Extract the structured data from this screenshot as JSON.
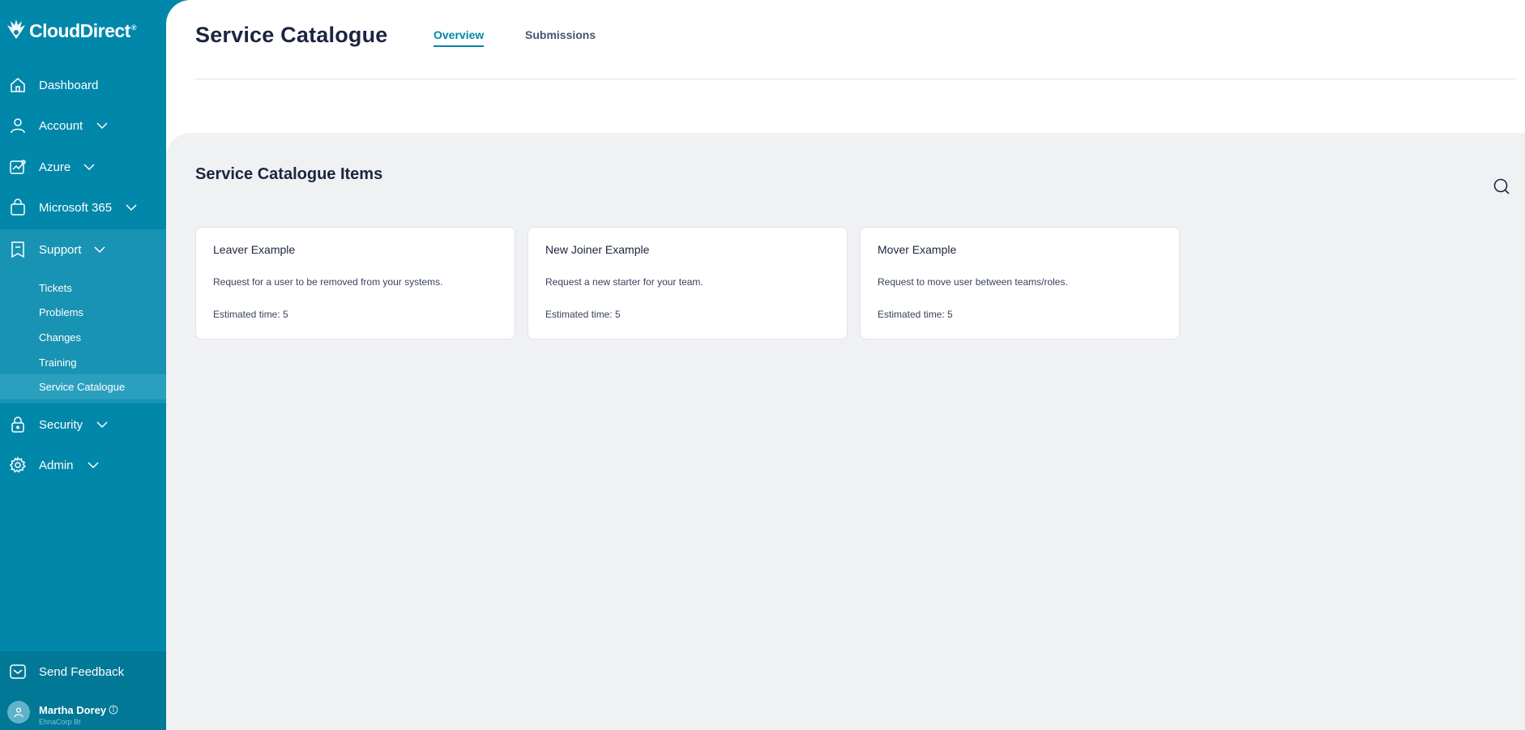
{
  "brand": {
    "name": "CloudDirect",
    "reg": "®",
    "primary_color": "#0087aa",
    "icon": "flame-logo-icon"
  },
  "sidebar": {
    "items": [
      {
        "label": "Dashboard",
        "icon": "home-icon",
        "expandable": false
      },
      {
        "label": "Account",
        "icon": "user-icon",
        "expandable": true
      },
      {
        "label": "Azure",
        "icon": "analytics-icon",
        "expandable": true
      },
      {
        "label": "Microsoft 365",
        "icon": "bag-icon",
        "expandable": true
      },
      {
        "label": "Support",
        "icon": "bookmark-icon",
        "expandable": true,
        "expanded": true
      },
      {
        "label": "Security",
        "icon": "lock-icon",
        "expandable": true
      },
      {
        "label": "Admin",
        "icon": "gear-icon",
        "expandable": true
      }
    ],
    "support_sub": [
      {
        "label": "Tickets"
      },
      {
        "label": "Problems"
      },
      {
        "label": "Changes"
      },
      {
        "label": "Training"
      },
      {
        "label": "Service Catalogue",
        "active": true
      }
    ],
    "feedback_label": "Send Feedback",
    "user": {
      "name": "Martha Dorey",
      "org": "EhnaCorp Bt"
    }
  },
  "header": {
    "title": "Service Catalogue",
    "tabs": [
      {
        "label": "Overview",
        "active": true
      },
      {
        "label": "Submissions",
        "active": false
      }
    ]
  },
  "catalogue": {
    "section_title": "Service Catalogue Items",
    "items": [
      {
        "title": "Leaver Example",
        "description": "Request for a user to be removed from your systems.",
        "time": "Estimated time: 5"
      },
      {
        "title": "New Joiner Example",
        "description": "Request a new starter for your team.",
        "time": "Estimated time: 5"
      },
      {
        "title": "Mover Example",
        "description": "Request to move user between teams/roles.",
        "time": "Estimated time: 5"
      }
    ]
  }
}
